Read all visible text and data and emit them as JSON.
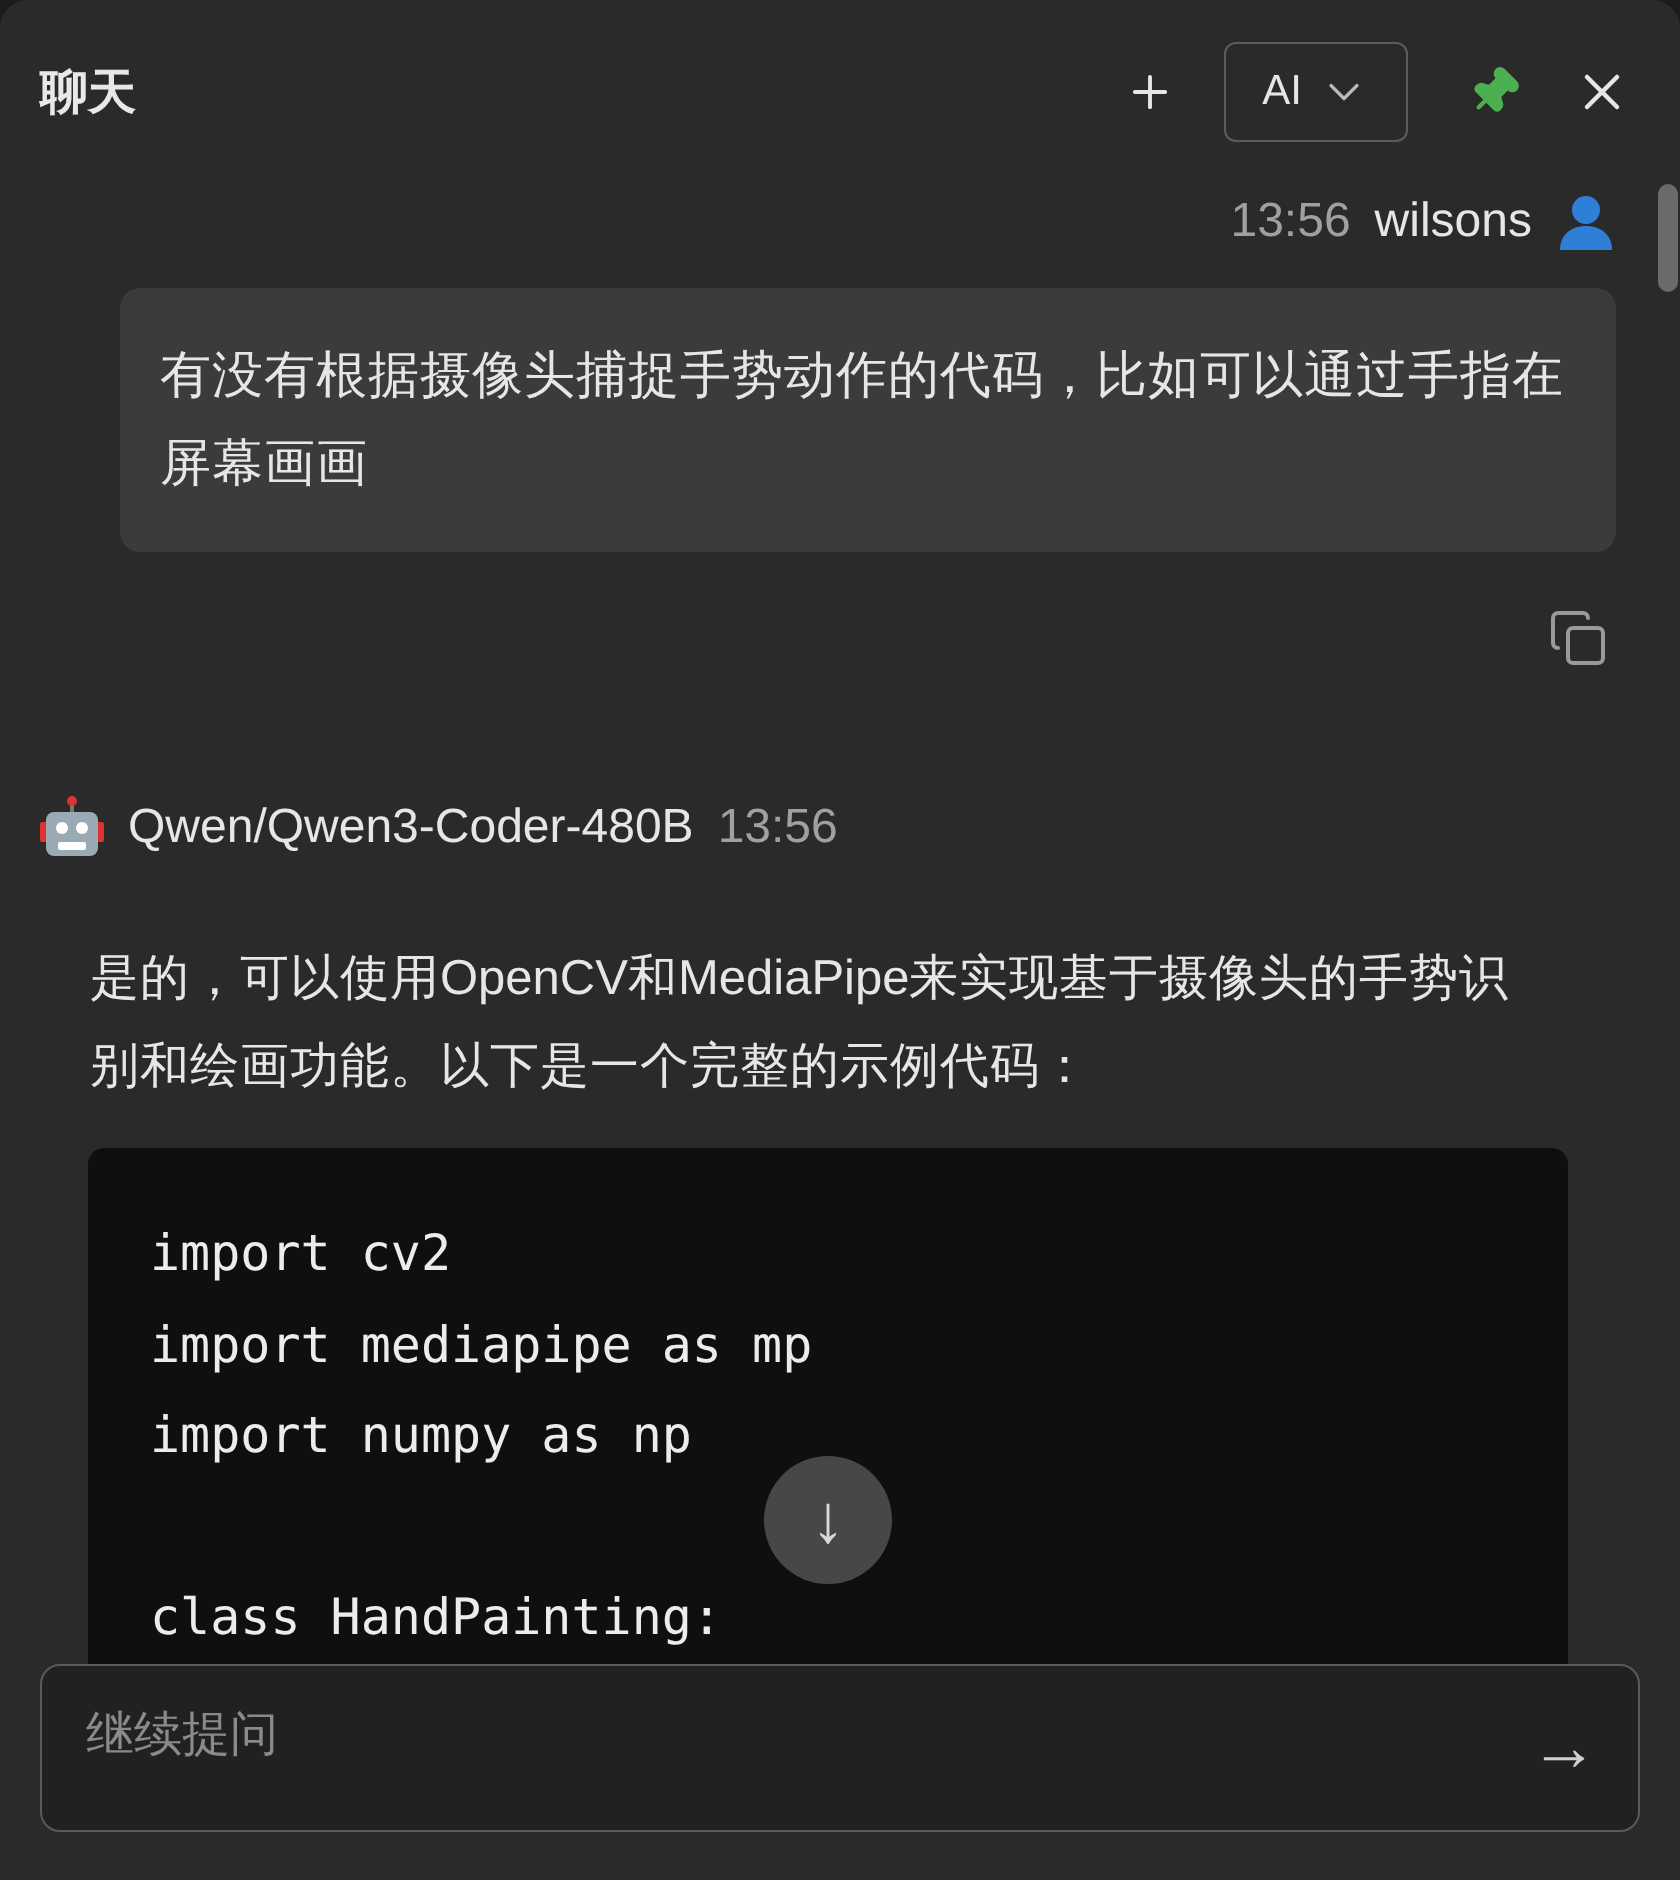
{
  "header": {
    "title": "聊天",
    "model_selector": {
      "label": "AI"
    },
    "pinned": true
  },
  "messages": [
    {
      "kind": "user",
      "time": "13:56",
      "author": "wilsons",
      "text": "有没有根据摄像头捕捉手势动作的代码，比如可以通过手指在屏幕画画"
    },
    {
      "kind": "assistant",
      "author": "Qwen/Qwen3-Coder-480B",
      "time": "13:56",
      "text": "是的，可以使用OpenCV和MediaPipe来实现基于摄像头的手势识别和绘画功能。以下是一个完整的示例代码：",
      "code": "import cv2\nimport mediapipe as mp\nimport numpy as np\n\nclass HandPainting:"
    }
  ],
  "scroll_down_button": {
    "label": "↓"
  },
  "composer": {
    "placeholder": "继续提问",
    "send_label": "→"
  }
}
